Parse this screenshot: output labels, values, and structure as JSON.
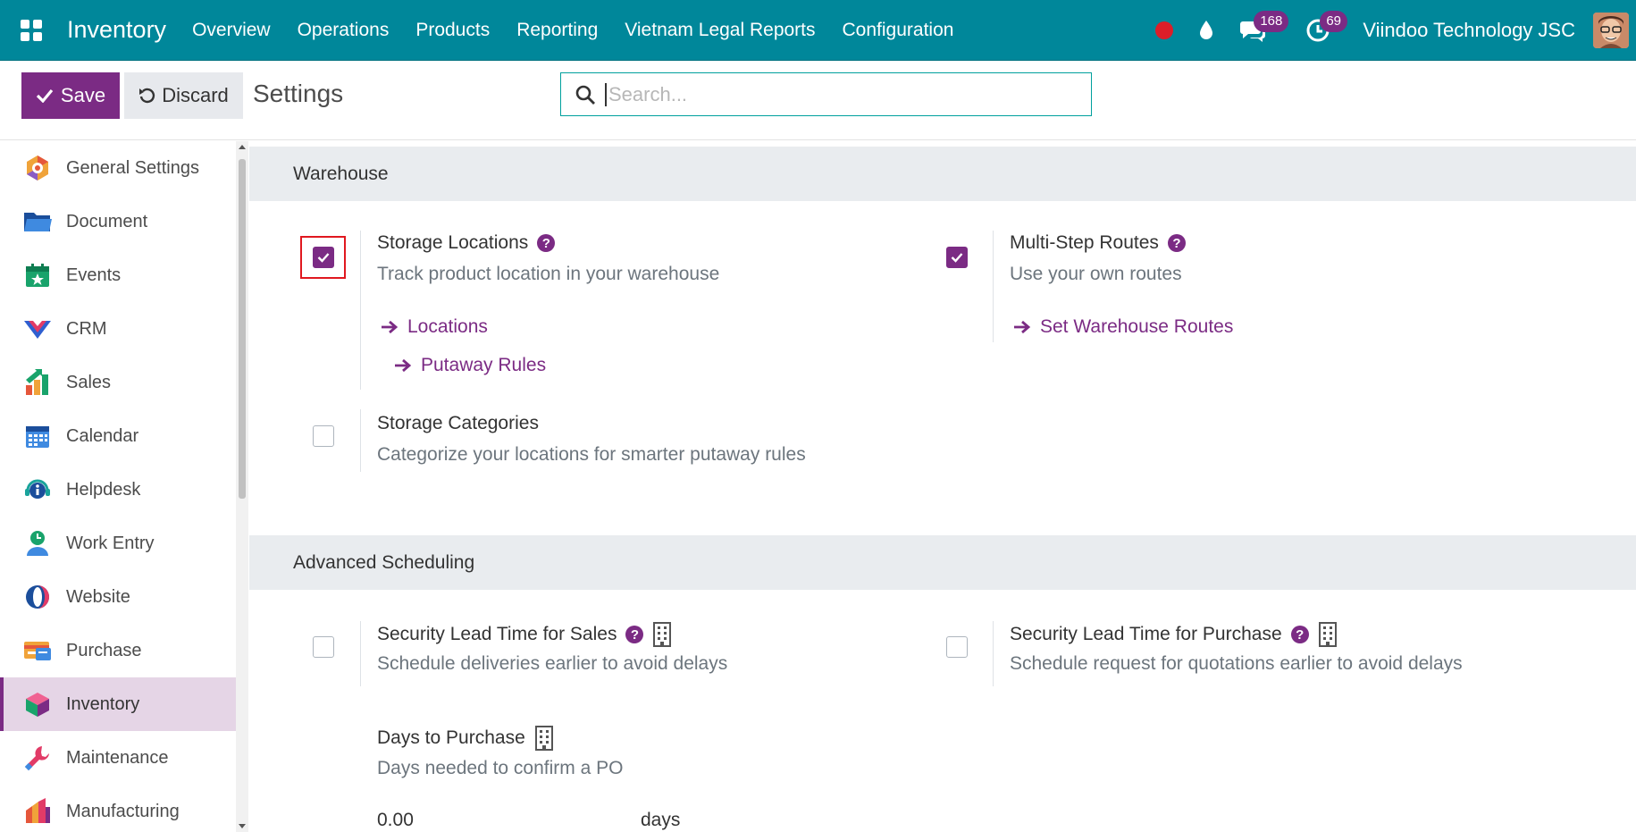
{
  "navbar": {
    "app_name": "Inventory",
    "menus": [
      "Overview",
      "Operations",
      "Products",
      "Reporting",
      "Vietnam Legal Reports",
      "Configuration"
    ],
    "chat_count": "168",
    "activity_count": "69",
    "company": "Viindoo Technology JSC"
  },
  "control_panel": {
    "save_label": "Save",
    "discard_label": "Discard",
    "title": "Settings",
    "search_placeholder": "Search..."
  },
  "sidebar": {
    "items": [
      {
        "label": "General Settings",
        "icon": "general-settings-icon"
      },
      {
        "label": "Document",
        "icon": "folder-icon"
      },
      {
        "label": "Events",
        "icon": "events-icon"
      },
      {
        "label": "CRM",
        "icon": "crm-icon"
      },
      {
        "label": "Sales",
        "icon": "sales-icon"
      },
      {
        "label": "Calendar",
        "icon": "calendar-icon"
      },
      {
        "label": "Helpdesk",
        "icon": "helpdesk-icon"
      },
      {
        "label": "Work Entry",
        "icon": "work-entry-icon"
      },
      {
        "label": "Website",
        "icon": "website-icon"
      },
      {
        "label": "Purchase",
        "icon": "purchase-icon"
      },
      {
        "label": "Inventory",
        "icon": "inventory-icon",
        "active": true
      },
      {
        "label": "Maintenance",
        "icon": "maintenance-icon"
      },
      {
        "label": "Manufacturing",
        "icon": "manufacturing-icon"
      }
    ]
  },
  "warehouse": {
    "header": "Warehouse",
    "storage_locations": {
      "title": "Storage Locations",
      "desc": "Track product location in your warehouse",
      "checked": true,
      "links": [
        "Locations",
        "Putaway Rules"
      ]
    },
    "multi_step_routes": {
      "title": "Multi-Step Routes",
      "desc": "Use your own routes",
      "checked": true,
      "links": [
        "Set Warehouse Routes"
      ]
    },
    "storage_categories": {
      "title": "Storage Categories",
      "desc": "Categorize your locations for smarter putaway rules",
      "checked": false
    }
  },
  "advanced_scheduling": {
    "header": "Advanced Scheduling",
    "lead_time_sales": {
      "title": "Security Lead Time for Sales",
      "desc": "Schedule deliveries earlier to avoid delays",
      "checked": false
    },
    "lead_time_purchase": {
      "title": "Security Lead Time for Purchase",
      "desc": "Schedule request for quotations earlier to avoid delays",
      "checked": false
    },
    "days_to_purchase": {
      "title": "Days to Purchase",
      "desc": "Days needed to confirm a PO",
      "value": "0.00",
      "unit": "days"
    }
  },
  "colors": {
    "navbar": "#00879a",
    "primary": "#7b2b84",
    "highlight": "#e0181f"
  }
}
